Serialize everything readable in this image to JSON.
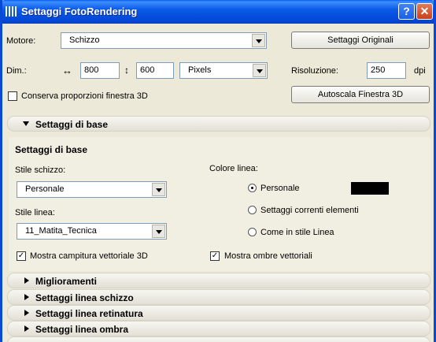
{
  "window": {
    "title": "Settaggi FotoRendering",
    "help_label": "?",
    "close_label": "✕"
  },
  "engine": {
    "label": "Motore:",
    "value": "Schizzo",
    "original_button": "Settaggi Originali"
  },
  "dimensions": {
    "label": "Dim.:",
    "width": "800",
    "height": "600",
    "unit": "Pixels"
  },
  "resolution": {
    "label": "Risoluzione:",
    "value": "250",
    "unit": "dpi"
  },
  "keep_proportions": {
    "label": "Conserva proporzioni finestra 3D",
    "checked": false
  },
  "autoscale_button": "Autoscala Finestra 3D",
  "basic_section": {
    "header": "Settaggi di base",
    "panel_title": "Settaggi di base",
    "sketch_style_label": "Stile schizzo:",
    "sketch_style_value": "Personale",
    "line_style_label": "Stile linea:",
    "line_style_value": "11_Matita_Tecnica",
    "line_color_label": "Colore linea:",
    "line_color_options": [
      "Personale",
      "Settaggi correnti elementi",
      "Come in stile Linea"
    ],
    "line_color_selected": "Personale",
    "line_color_swatch": "#000000",
    "vector_fill_label": "Mostra campitura vettoriale 3D",
    "vector_fill_checked": true,
    "vector_shadows_label": "Mostra ombre vettoriali",
    "vector_shadows_checked": true
  },
  "collapsed_sections": [
    "Miglioramenti",
    "Settaggi linea schizzo",
    "Settaggi linea retinatura",
    "Settaggi linea ombra"
  ]
}
